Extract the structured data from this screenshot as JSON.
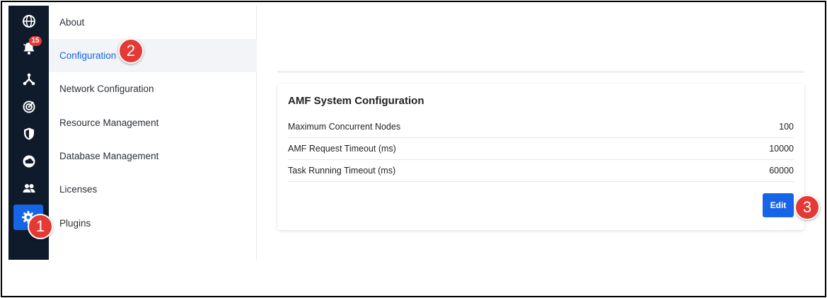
{
  "rail": {
    "notification_count": "15",
    "icons": [
      "globe-icon",
      "bell-icon",
      "network-icon",
      "radar-icon",
      "shield-icon",
      "cloud-icon",
      "users-icon",
      "gear-icon"
    ],
    "active_color": "#1565e6",
    "background_color": "#0f1a2b"
  },
  "menu": {
    "items": [
      {
        "label": "About"
      },
      {
        "label": "Configuration"
      },
      {
        "label": "Network Configuration"
      },
      {
        "label": "Resource Management"
      },
      {
        "label": "Database Management"
      },
      {
        "label": "Licenses"
      },
      {
        "label": "Plugins"
      }
    ],
    "active_index": 1
  },
  "card": {
    "title": "AMF System Configuration",
    "rows": [
      {
        "label": "Maximum Concurrent Nodes",
        "value": "100"
      },
      {
        "label": "AMF Request Timeout (ms)",
        "value": "10000"
      },
      {
        "label": "Task Running Timeout (ms)",
        "value": "60000"
      }
    ],
    "edit_label": "Edit"
  },
  "callouts": [
    "1",
    "2",
    "3"
  ],
  "callout_color": "#e53935"
}
